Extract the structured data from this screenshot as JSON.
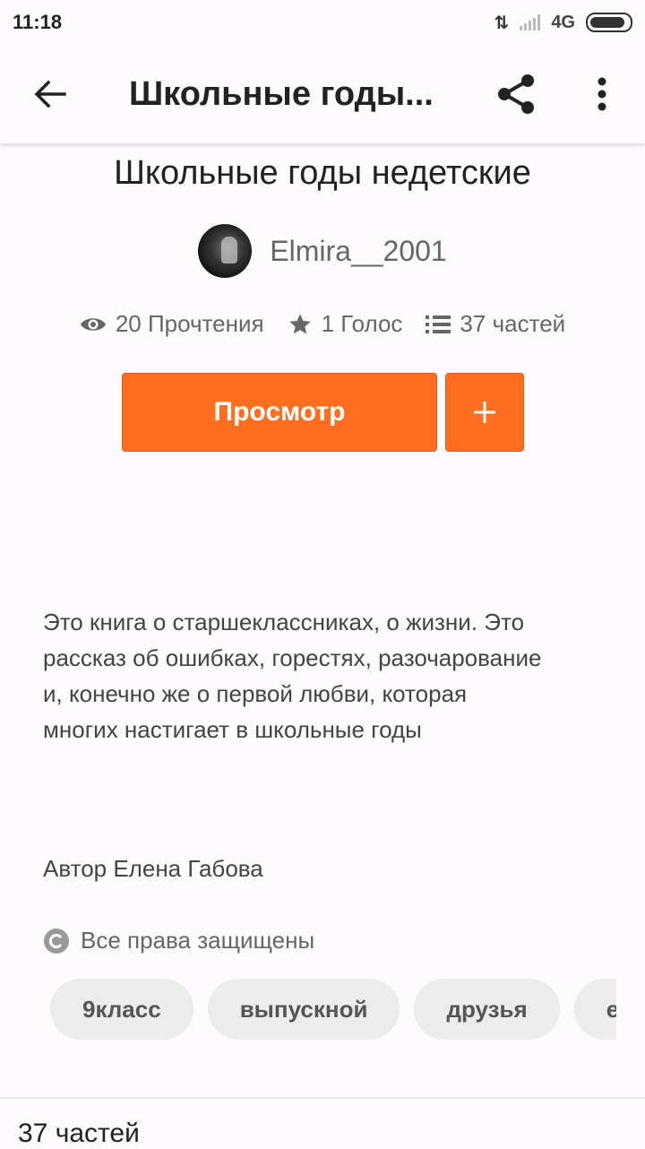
{
  "status_bar": {
    "time": "11:18",
    "network": "4G",
    "battery_level": 0.9
  },
  "app_bar": {
    "title": "Школьные годы..."
  },
  "story": {
    "title": "Школьные годы недетские",
    "author": "Elmira__2001",
    "stats": {
      "reads": "20 Прочтения",
      "votes": "1 Голос",
      "parts": "37 частей"
    },
    "read_button": "Просмотр",
    "description_lines": [
      "Это книга о старшеклассниках,  о жизни.  Это",
      "рассказ об ошибках,  горестях,  разочарование",
      "и,  конечно же о первой любви,  которая",
      "многих настигает в школьные годы"
    ],
    "author_credit": "Автор Елена Габова",
    "copyright": "Все права защищены",
    "tags": [
      "9класс",
      "выпускной",
      "друзья",
      "еле"
    ]
  },
  "parts_section": {
    "heading": "37 частей"
  },
  "colors": {
    "accent": "#ff6d1f",
    "background": "#fdfbfd",
    "tag_bg": "#ececec"
  }
}
